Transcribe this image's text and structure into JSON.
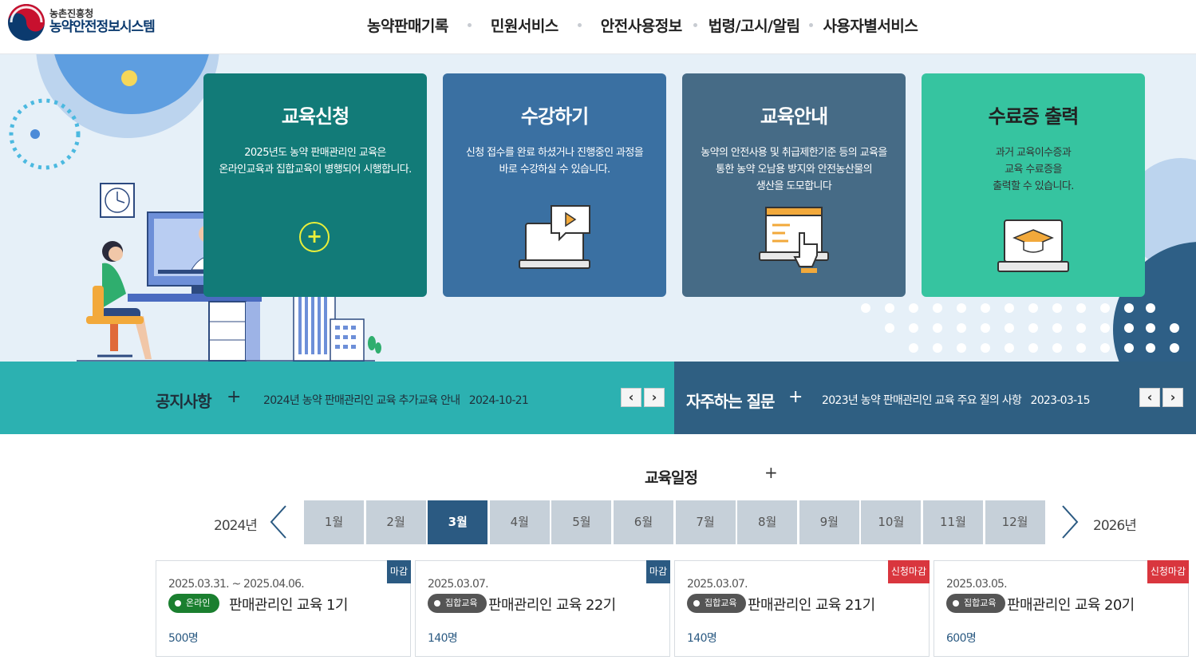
{
  "header": {
    "org": "농촌진흥청",
    "system_name": "농약안전정보시스템",
    "nav": [
      "농약판매기록",
      "민원서비스",
      "안전사용정보",
      "법령/고시/알림",
      "사용자별서비스"
    ]
  },
  "hero": {
    "cards": [
      {
        "title": "교육신청",
        "desc": [
          "2025년도 농약 판매관리인 교육은",
          "온라인교육과 집합교육이 병행되어 시행합니다."
        ],
        "color": "#127b78",
        "icon": "plus-circle-icon"
      },
      {
        "title": "수강하기",
        "desc": [
          "신청 접수를 완료 하셨거나 진행중인 과정을",
          "바로 수강하실 수 있습니다."
        ],
        "color": "#3a70a2",
        "icon": "laptop-play-icon"
      },
      {
        "title": "교육안내",
        "desc": [
          "농약의 안전사용 및 취급제한기준 등의 교육을",
          "통한 농약 오남용 방지와 안전농산물의",
          "생산을 도모합니다"
        ],
        "color": "#466b86",
        "icon": "touch-screen-icon"
      },
      {
        "title": "수료증 출력",
        "desc": [
          "과거 교육이수증과",
          "교육 수료증을",
          "출력할 수 있습니다."
        ],
        "color": "#36c4a0",
        "icon": "graduation-cap-laptop-icon"
      }
    ]
  },
  "notice": {
    "title": "공지사항",
    "plus": "+",
    "text": "2024년 농약 판매관리인 교육 추가교육 안내",
    "date": "2024-10-21",
    "prev": "‹",
    "next": "›"
  },
  "faq": {
    "title": "자주하는 질문",
    "plus": "+",
    "text": "2023년 농약 판매관리인 교육 주요 질의 사항",
    "date": "2023-03-15",
    "prev": "‹",
    "next": "›"
  },
  "schedule": {
    "title": "교육일정",
    "plus": "+",
    "prev_year": "2024년",
    "next_year": "2026년",
    "months": [
      "1월",
      "2월",
      "3월",
      "4월",
      "5월",
      "6월",
      "7월",
      "8월",
      "9월",
      "10월",
      "11월",
      "12월"
    ],
    "active_month": "3월",
    "events": [
      {
        "date": "2025.03.31. ~ 2025.04.06.",
        "type": "온라인",
        "name": "판매관리인 교육 1기",
        "count": "500명",
        "badge": "마감",
        "badge_color": "#2b5a82",
        "type_color": "#1a7f2f"
      },
      {
        "date": "2025.03.07.",
        "type": "집합교육",
        "name": "판매관리인 교육 22기",
        "count": "140명",
        "badge": "마감",
        "badge_color": "#2b5a82",
        "type_color": "#555555"
      },
      {
        "date": "2025.03.07.",
        "type": "집합교육",
        "name": "판매관리인 교육 21기",
        "count": "140명",
        "badge": "신청마감",
        "badge_color": "#d9363e",
        "type_color": "#555555"
      },
      {
        "date": "2025.03.05.",
        "type": "집합교육",
        "name": "판매관리인 교육 20기",
        "count": "600명",
        "badge": "신청마감",
        "badge_color": "#d9363e",
        "type_color": "#555555"
      }
    ]
  }
}
